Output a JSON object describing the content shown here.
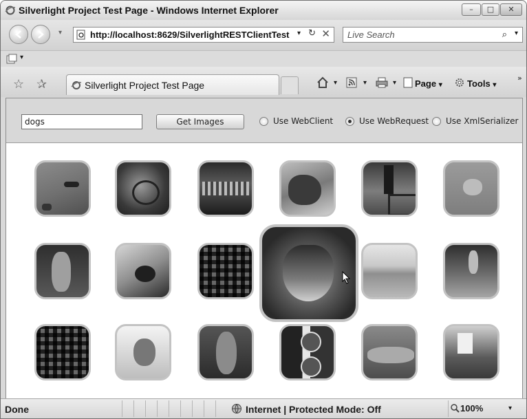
{
  "window": {
    "title": "Silverlight Project Test Page - Windows Internet Explorer",
    "controls": {
      "minimize": "–",
      "maximize": "□",
      "close": "✕"
    }
  },
  "addressbar": {
    "url": "http://localhost:8629/SilverlightRESTClientTest",
    "dropdown": "▾",
    "refresh": "↻",
    "stop": "✕"
  },
  "search": {
    "placeholder": "Live Search",
    "icon": "⌕",
    "dropdown": "▾"
  },
  "tab": {
    "title": "Silverlight Project Test Page"
  },
  "toolbar": {
    "page_label": "Page",
    "tools_label": "Tools",
    "chevron": "»",
    "dd": "▾"
  },
  "app": {
    "search_value": "dogs",
    "get_images_label": "Get Images",
    "options": [
      {
        "label": "Use WebClient",
        "selected": false
      },
      {
        "label": "Use WebRequest",
        "selected": true
      },
      {
        "label": "Use XmlSerializer",
        "selected": false
      }
    ]
  },
  "status": {
    "text": "Done",
    "zone": "Internet | Protected Mode: Off",
    "zoom": "100%"
  },
  "colors": {
    "chrome": "#d9d9d9",
    "thumb_border": "#c3c3c3"
  }
}
